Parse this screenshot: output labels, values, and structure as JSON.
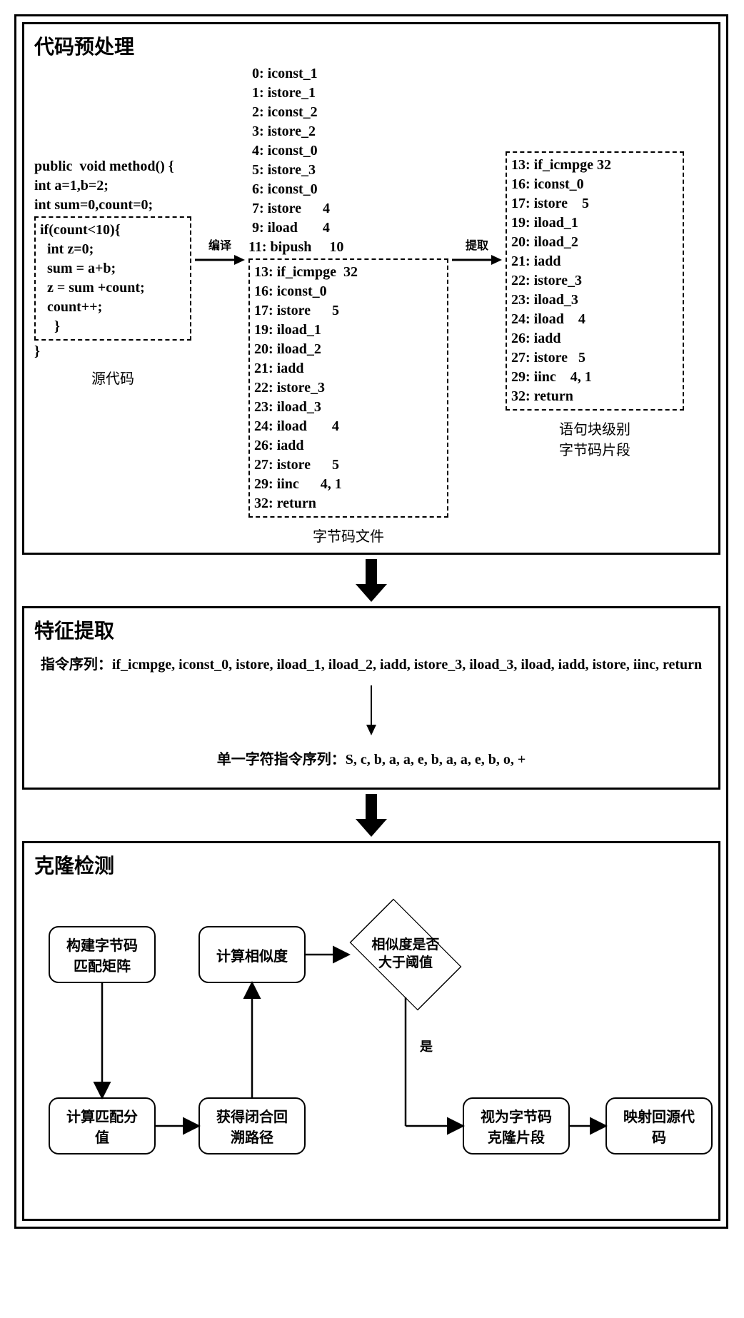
{
  "panel1": {
    "title": "代码预处理",
    "source": {
      "caption": "源代码",
      "pre": "public  void method() {\nint a=1,b=2;\nint sum=0,count=0;",
      "boxed": "if(count<10){\n  int z=0;\n  sum = a+b;\n  z = sum +count;\n  count++;\n    }",
      "post": "}"
    },
    "arrow1": "编译",
    "bytecode": {
      "caption": "字节码文件",
      "pre": [
        " 0: iconst_1",
        " 1: istore_1",
        " 2: iconst_2",
        " 3: istore_2",
        " 4: iconst_0",
        " 5: istore_3",
        " 6: iconst_0",
        " 7: istore      4",
        " 9: iload       4",
        "11: bipush     10"
      ],
      "boxed": [
        "13: if_icmpge  32",
        "16: iconst_0",
        "17: istore      5",
        "19: iload_1",
        "20: iload_2",
        "21: iadd",
        "22: istore_3",
        "23: iload_3",
        "24: iload       4",
        "26: iadd",
        "27: istore      5",
        "29: iinc      4, 1",
        "32: return"
      ]
    },
    "arrow2": "提取",
    "fragment": {
      "caption": "语句块级别\n字节码片段",
      "lines": [
        "13: if_icmpge 32",
        "16: iconst_0",
        "17: istore    5",
        "19: iload_1",
        "20: iload_2",
        "21: iadd",
        "22: istore_3",
        "23: iload_3",
        "24: iload    4",
        "26: iadd",
        "27: istore   5",
        "29: iinc    4, 1",
        "32: return"
      ]
    }
  },
  "panel2": {
    "title": "特征提取",
    "seq_label": "指令序列：",
    "seq_value": "if_icmpge, iconst_0, istore, iload_1, iload_2, iadd, istore_3, iload_3,  iload, iadd, istore, iinc, return",
    "char_label": "单一字符指令序列：",
    "char_value": "S, c, b, a, a, e, b, a, a, e, b, o, +"
  },
  "panel3": {
    "title": "克隆检测",
    "n1": "构建字节码\n匹配矩阵",
    "n2": "计算匹配分\n值",
    "n3": "获得闭合回\n溯路径",
    "n4": "计算相似度",
    "n5": "相似度是否\n大于阈值",
    "yes": "是",
    "n6": "视为字节码\n克隆片段",
    "n7": "映射回源代\n码"
  }
}
